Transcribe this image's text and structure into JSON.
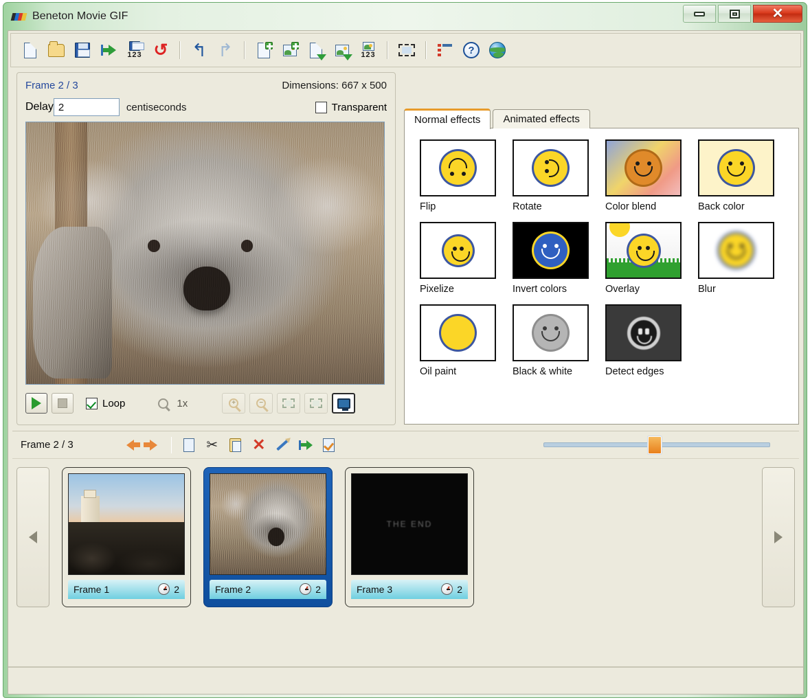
{
  "window": {
    "title": "Beneton Movie GIF",
    "app_icon": "film-strip-icon",
    "buttons": {
      "minimize": "–",
      "maximize": "□",
      "close": "✕"
    }
  },
  "toolbar": {
    "items": [
      {
        "name": "new-file",
        "icon": "new-document-icon"
      },
      {
        "name": "open-file",
        "icon": "open-folder-icon"
      },
      {
        "name": "save-file",
        "icon": "floppy-save-icon"
      },
      {
        "name": "save-as",
        "icon": "save-arrow-icon"
      },
      {
        "name": "save-sequence",
        "icon": "save-sequence-123-icon",
        "badge": "123"
      },
      {
        "name": "refresh",
        "icon": "refresh-icon"
      },
      {
        "name": "undo",
        "icon": "undo-arrow-icon"
      },
      {
        "name": "redo",
        "icon": "redo-arrow-icon"
      },
      {
        "name": "add-frame",
        "icon": "add-document-icon"
      },
      {
        "name": "add-image",
        "icon": "add-image-icon"
      },
      {
        "name": "insert-frame",
        "icon": "insert-document-icon"
      },
      {
        "name": "insert-image",
        "icon": "insert-image-icon"
      },
      {
        "name": "insert-sequence",
        "icon": "insert-sequence-123-icon",
        "badge": "123"
      },
      {
        "name": "resize-canvas",
        "icon": "resize-icon"
      },
      {
        "name": "frame-list-view",
        "icon": "list-view-icon"
      },
      {
        "name": "help",
        "icon": "help-question-icon"
      },
      {
        "name": "website",
        "icon": "globe-icon"
      }
    ]
  },
  "preview": {
    "frame_label": "Frame 2 / 3",
    "dimensions_label": "Dimensions: 667 x 500",
    "delay_label": "Delay",
    "delay_value": "2",
    "delay_unit": "centiseconds",
    "transparent_label": "Transparent",
    "transparent_checked": false,
    "image_alt": "koala"
  },
  "playback": {
    "play": "play-button",
    "stop": "stop-button",
    "loop_label": "Loop",
    "loop_checked": true,
    "zoom_level": "1x",
    "zoom_in": "zoom-in-button",
    "zoom_out": "zoom-out-button",
    "fit": "fit-to-window-button",
    "actual": "actual-size-button",
    "fullscreen": "full-screen-button"
  },
  "effects": {
    "tabs": [
      {
        "label": "Normal effects",
        "active": true
      },
      {
        "label": "Animated effects",
        "active": false
      }
    ],
    "items": [
      {
        "label": "Flip",
        "thumb": "flip"
      },
      {
        "label": "Rotate",
        "thumb": "rotate"
      },
      {
        "label": "Color blend",
        "thumb": "colorblend"
      },
      {
        "label": "Back color",
        "thumb": "backcolor"
      },
      {
        "label": "Pixelize",
        "thumb": "pixelize"
      },
      {
        "label": "Invert colors",
        "thumb": "invert"
      },
      {
        "label": "Overlay",
        "thumb": "overlay"
      },
      {
        "label": "Blur",
        "thumb": "blur"
      },
      {
        "label": "Oil paint",
        "thumb": "oilpaint"
      },
      {
        "label": "Black & white",
        "thumb": "blackwhite"
      },
      {
        "label": "Detect edges",
        "thumb": "detectedges"
      }
    ]
  },
  "frame_toolbar": {
    "frame_label": "Frame 2 / 3",
    "prev": "previous-frame-button",
    "next": "next-frame-button",
    "copy": "copy-frame-button",
    "cut": "cut-frame-button",
    "paste": "paste-frame-button",
    "delete": "delete-frame-button",
    "edit": "edit-frame-button",
    "export": "export-frame-button",
    "select": "select-frame-button",
    "slider_value": 46
  },
  "frames": {
    "scroll_left": "scroll-left-button",
    "scroll_right": "scroll-right-button",
    "items": [
      {
        "label": "Frame 1",
        "delay": "2",
        "selected": false,
        "thumb": "lighthouse"
      },
      {
        "label": "Frame 2",
        "delay": "2",
        "selected": true,
        "thumb": "koala"
      },
      {
        "label": "Frame 3",
        "delay": "2",
        "selected": false,
        "thumb": "black",
        "overlay_text": "THE END"
      }
    ]
  },
  "colors": {
    "title_bar": "#cfe8cf",
    "client_bg": "#eceadd",
    "accent_orange": "#e79b2b",
    "selection_blue": "#1e63b8",
    "caption_cyan": "#6fcfe0",
    "link_blue": "#24489c"
  }
}
